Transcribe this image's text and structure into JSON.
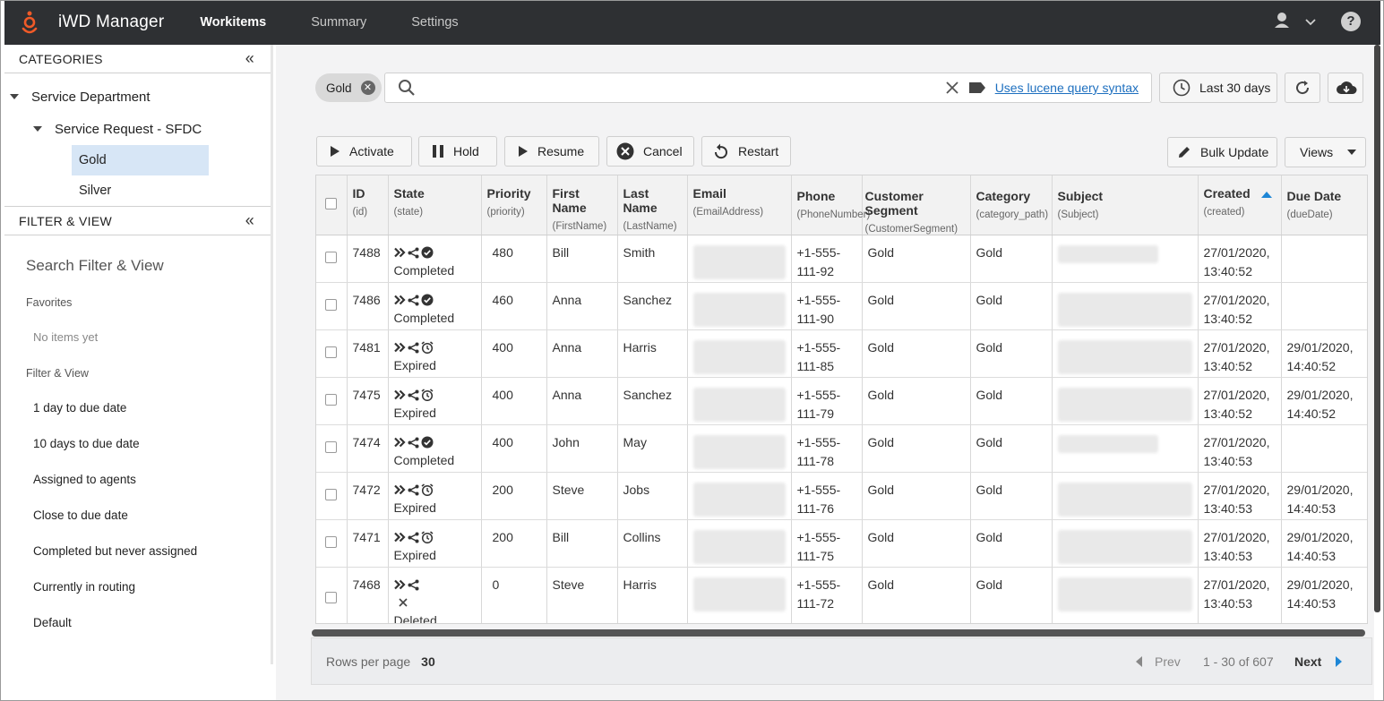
{
  "app": {
    "title": "iWD Manager"
  },
  "nav": [
    {
      "label": "Workitems",
      "active": true
    },
    {
      "label": "Summary",
      "active": false
    },
    {
      "label": "Settings",
      "active": false
    }
  ],
  "sidebar": {
    "categories_title": "CATEGORIES",
    "collapse_glyph": "«",
    "tree": {
      "department": "Service Department",
      "process": "Service Request - SFDC",
      "leaves": [
        {
          "label": "Gold",
          "selected": true
        },
        {
          "label": "Silver",
          "selected": false
        }
      ]
    },
    "filter_title": "FILTER & VIEW",
    "search_label": "Search Filter & View",
    "favorites_label": "Favorites",
    "favorites_empty": "No items yet",
    "filter_view_label": "Filter & View",
    "filter_items": [
      "1 day to due date",
      "10 days to due date",
      "Assigned to agents",
      "Close to due date",
      "Completed but never assigned",
      "Currently in routing",
      "Default"
    ]
  },
  "toolbar": {
    "chip_label": "Gold",
    "search_value": "",
    "search_placeholder": "",
    "lucene_link": "Uses lucene query syntax",
    "date_range": "Last 30 days",
    "actions": {
      "activate": "Activate",
      "hold": "Hold",
      "resume": "Resume",
      "cancel": "Cancel",
      "restart": "Restart"
    },
    "bulk_update": "Bulk Update",
    "views": "Views"
  },
  "table": {
    "columns": [
      {
        "label": "ID",
        "sub": "(id)"
      },
      {
        "label": "State",
        "sub": "(state)"
      },
      {
        "label": "Priority",
        "sub": "(priority)"
      },
      {
        "label": "First Name",
        "sub": "(FirstName)"
      },
      {
        "label": "Last Name",
        "sub": "(LastName)"
      },
      {
        "label": "Email",
        "sub": "(EmailAddress)"
      },
      {
        "label": "Phone",
        "sub": "(PhoneNumber)"
      },
      {
        "label": "Customer Segment",
        "sub": "(CustomerSegment)"
      },
      {
        "label": "Category",
        "sub": "(category_path)"
      },
      {
        "label": "Subject",
        "sub": "(Subject)"
      },
      {
        "label": "Created",
        "sub": "(created)"
      },
      {
        "label": "Due Date",
        "sub": "(dueDate)"
      }
    ],
    "rows": [
      {
        "id": "7488",
        "state": "Completed",
        "status_icon": "check-circle",
        "priority": "480",
        "first": "Bill",
        "last": "Smith",
        "phone": "+1-555-111-92",
        "segment": "Gold",
        "category": "Gold",
        "created": "27/01/2020, 13:40:52",
        "due": ""
      },
      {
        "id": "7486",
        "state": "Completed",
        "status_icon": "check-circle",
        "priority": "460",
        "first": "Anna",
        "last": "Sanchez",
        "phone": "+1-555-111-90",
        "segment": "Gold",
        "category": "Gold",
        "created": "27/01/2020, 13:40:52",
        "due": ""
      },
      {
        "id": "7481",
        "state": "Expired",
        "status_icon": "alarm-clock",
        "priority": "400",
        "first": "Anna",
        "last": "Harris",
        "phone": "+1-555-111-85",
        "segment": "Gold",
        "category": "Gold",
        "created": "27/01/2020, 13:40:52",
        "due": "29/01/2020, 14:40:52"
      },
      {
        "id": "7475",
        "state": "Expired",
        "status_icon": "alarm-clock",
        "priority": "400",
        "first": "Anna",
        "last": "Sanchez",
        "phone": "+1-555-111-79",
        "segment": "Gold",
        "category": "Gold",
        "created": "27/01/2020, 13:40:52",
        "due": "29/01/2020, 14:40:52"
      },
      {
        "id": "7474",
        "state": "Completed",
        "status_icon": "check-circle",
        "priority": "400",
        "first": "John",
        "last": "May",
        "phone": "+1-555-111-78",
        "segment": "Gold",
        "category": "Gold",
        "created": "27/01/2020, 13:40:53",
        "due": ""
      },
      {
        "id": "7472",
        "state": "Expired",
        "status_icon": "alarm-clock",
        "priority": "200",
        "first": "Steve",
        "last": "Jobs",
        "phone": "+1-555-111-76",
        "segment": "Gold",
        "category": "Gold",
        "created": "27/01/2020, 13:40:53",
        "due": "29/01/2020, 14:40:53"
      },
      {
        "id": "7471",
        "state": "Expired",
        "status_icon": "alarm-clock",
        "priority": "200",
        "first": "Bill",
        "last": "Collins",
        "phone": "+1-555-111-75",
        "segment": "Gold",
        "category": "Gold",
        "created": "27/01/2020, 13:40:53",
        "due": "29/01/2020, 14:40:53"
      },
      {
        "id": "7468",
        "state": "Deleted",
        "status_icon": "x-mark",
        "priority": "0",
        "first": "Steve",
        "last": "Harris",
        "phone": "+1-555-111-72",
        "segment": "Gold",
        "category": "Gold",
        "created": "27/01/2020, 13:40:53",
        "due": "29/01/2020, 14:40:53"
      }
    ]
  },
  "pager": {
    "rows_per_page_label": "Rows per page",
    "rows_per_page": "30",
    "prev": "Prev",
    "range": "1 - 30 of 607",
    "next": "Next"
  },
  "colors": {
    "header_bg": "#2e3033",
    "logo": "#f05a28",
    "link": "#1d6fbf",
    "selected_bg": "#d7e6f6",
    "sort_accent": "#1d86d6"
  }
}
